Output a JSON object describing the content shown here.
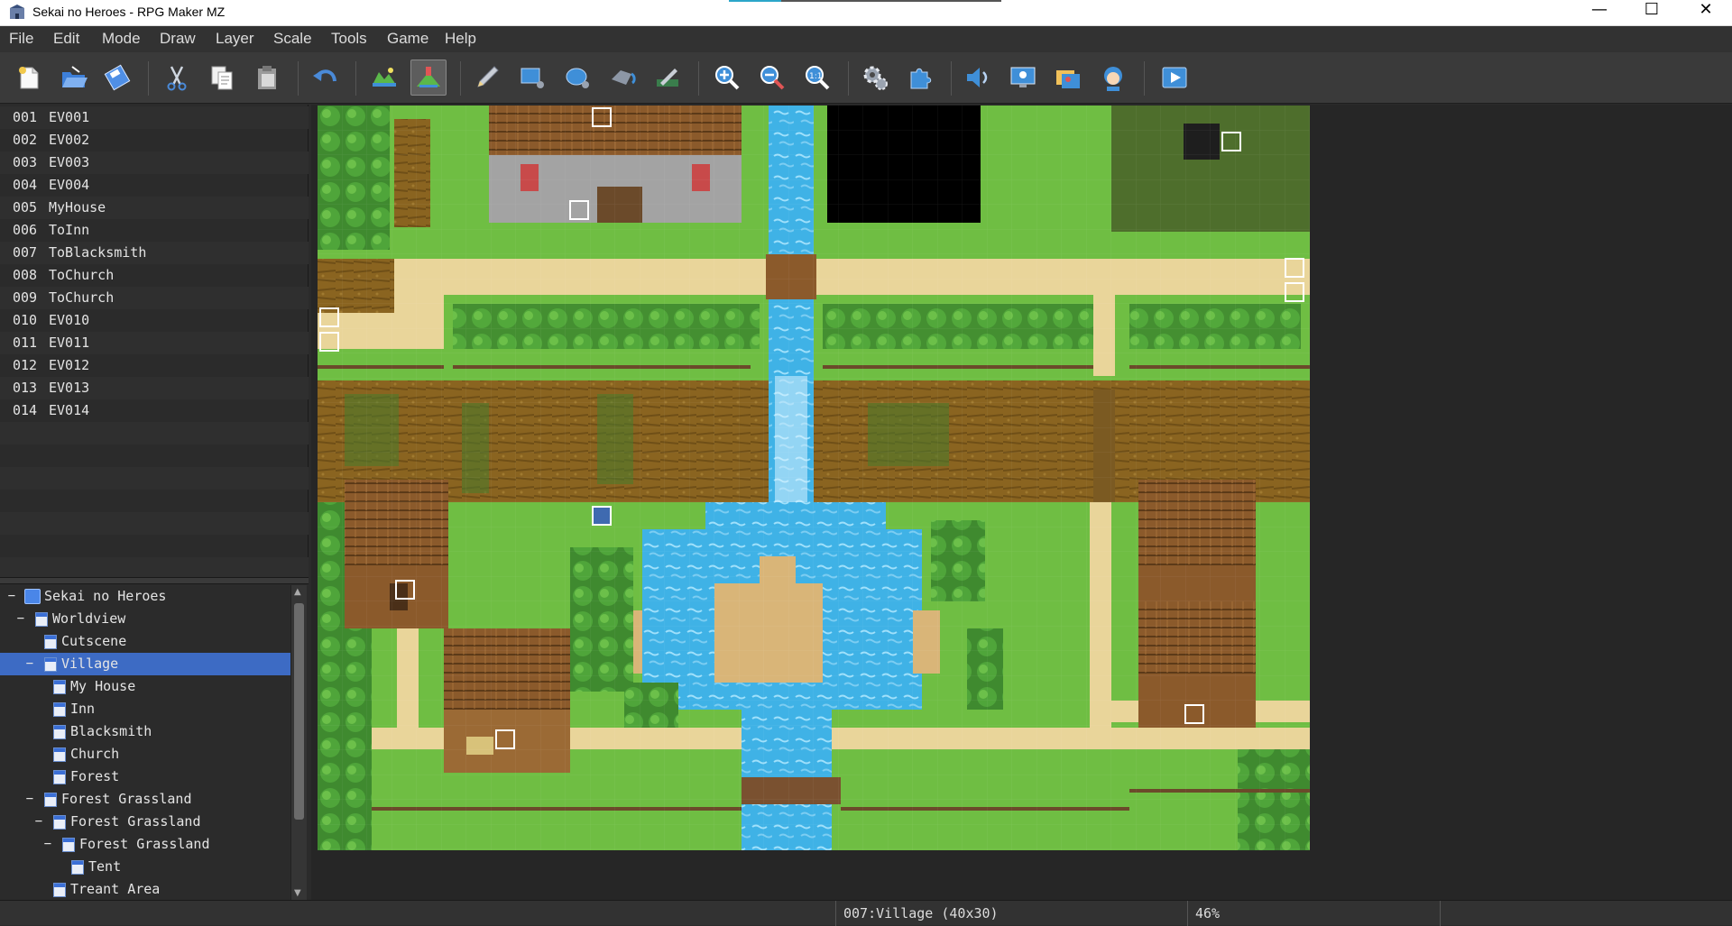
{
  "window": {
    "title": "Sekai no Heroes - RPG Maker MZ",
    "controls": {
      "minimize": "—",
      "maximize": "☐",
      "close": "✕"
    }
  },
  "menu": [
    "File",
    "Edit",
    "Mode",
    "Draw",
    "Layer",
    "Scale",
    "Tools",
    "Game",
    "Help"
  ],
  "toolbar": {
    "tools": [
      {
        "name": "new-project-icon",
        "group": "file"
      },
      {
        "name": "open-project-icon",
        "group": "file"
      },
      {
        "name": "save-project-icon",
        "group": "file"
      },
      {
        "name": "cut-icon",
        "group": "edit"
      },
      {
        "name": "copy-icon",
        "group": "edit"
      },
      {
        "name": "paste-icon",
        "group": "edit"
      },
      {
        "name": "undo-icon",
        "group": "undo"
      },
      {
        "name": "map-mode-icon",
        "group": "mode"
      },
      {
        "name": "event-mode-icon",
        "group": "mode",
        "active": true
      },
      {
        "name": "pencil-icon",
        "group": "draw"
      },
      {
        "name": "rectangle-icon",
        "group": "draw"
      },
      {
        "name": "ellipse-icon",
        "group": "draw"
      },
      {
        "name": "flood-fill-icon",
        "group": "draw"
      },
      {
        "name": "shadow-pen-icon",
        "group": "draw"
      },
      {
        "name": "zoom-in-icon",
        "group": "scale"
      },
      {
        "name": "zoom-out-icon",
        "group": "scale"
      },
      {
        "name": "actual-size-icon",
        "group": "scale"
      },
      {
        "name": "database-icon",
        "group": "tools"
      },
      {
        "name": "plugin-manager-icon",
        "group": "tools"
      },
      {
        "name": "sound-test-icon",
        "group": "tools"
      },
      {
        "name": "event-searcher-icon",
        "group": "tools"
      },
      {
        "name": "resource-manager-icon",
        "group": "tools"
      },
      {
        "name": "character-generator-icon",
        "group": "tools"
      },
      {
        "name": "playtest-icon",
        "group": "game"
      }
    ]
  },
  "events": [
    {
      "num": "001",
      "name": "EV001"
    },
    {
      "num": "002",
      "name": "EV002"
    },
    {
      "num": "003",
      "name": "EV003"
    },
    {
      "num": "004",
      "name": "EV004"
    },
    {
      "num": "005",
      "name": "MyHouse"
    },
    {
      "num": "006",
      "name": "ToInn"
    },
    {
      "num": "007",
      "name": "ToBlacksmith"
    },
    {
      "num": "008",
      "name": "ToChurch"
    },
    {
      "num": "009",
      "name": "ToChurch"
    },
    {
      "num": "010",
      "name": "EV010"
    },
    {
      "num": "011",
      "name": "EV011"
    },
    {
      "num": "012",
      "name": "EV012"
    },
    {
      "num": "013",
      "name": "EV013"
    },
    {
      "num": "014",
      "name": "EV014"
    }
  ],
  "map_tree": [
    {
      "label": "Sekai no Heroes",
      "depth": 0,
      "toggle": "−",
      "root": true
    },
    {
      "label": "Worldview",
      "depth": 1,
      "toggle": "−"
    },
    {
      "label": "Cutscene",
      "depth": 2,
      "toggle": ""
    },
    {
      "label": "Village",
      "depth": 2,
      "toggle": "−",
      "selected": true
    },
    {
      "label": "My House",
      "depth": 3,
      "toggle": ""
    },
    {
      "label": "Inn",
      "depth": 3,
      "toggle": ""
    },
    {
      "label": "Blacksmith",
      "depth": 3,
      "toggle": ""
    },
    {
      "label": "Church",
      "depth": 3,
      "toggle": ""
    },
    {
      "label": "Forest",
      "depth": 3,
      "toggle": ""
    },
    {
      "label": "Forest Grassland",
      "depth": 2,
      "toggle": "−"
    },
    {
      "label": "Forest Grassland",
      "depth": 3,
      "toggle": "−"
    },
    {
      "label": "Forest Grassland",
      "depth": 4,
      "toggle": "−"
    },
    {
      "label": "Tent",
      "depth": 5,
      "toggle": ""
    },
    {
      "label": "Treant Area",
      "depth": 3,
      "toggle": ""
    }
  ],
  "status": {
    "map_info": "007:Village (40x30)",
    "zoom": "46%"
  },
  "colors": {
    "selection": "#3d6bc4",
    "grass": "#6fbe43",
    "water": "#3fb2e6",
    "path": "#e9d59a",
    "cliff": "#8a6420",
    "roof": "#8b5a2b"
  }
}
